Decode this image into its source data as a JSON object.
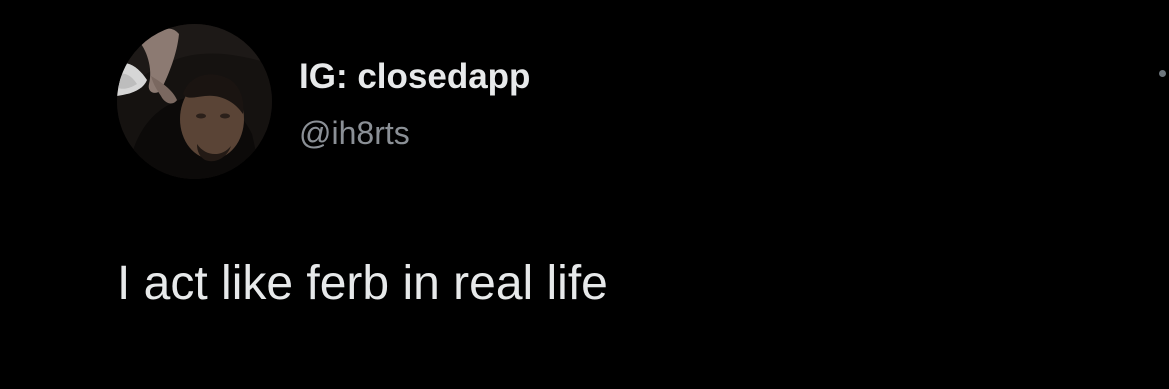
{
  "tweet": {
    "author": {
      "display_name": "IG: closedapp",
      "handle": "@ih8rts",
      "avatar": "profile-photo"
    },
    "text": "I act like ferb in real life",
    "more_menu_icon": "more-options-icon"
  },
  "colors": {
    "background": "#000000",
    "primary_text": "#e7e9ea",
    "secondary_text": "#8b9096"
  }
}
